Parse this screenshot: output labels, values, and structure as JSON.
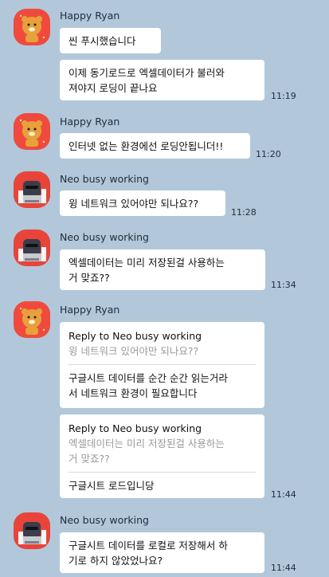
{
  "users": {
    "ryan": "Happy Ryan",
    "neo": "Neo busy working"
  },
  "messages": {
    "m1": "씬 푸시했습니다",
    "m2_line1": "이제 동기로드로 엑셀데이터가 불러와",
    "m2_line2": "져야지 로딩이 끝나요",
    "m3": "인터넷 없는 환경에선 로딩안됩니더!!",
    "m4": "윙 네트워크 있어야만 되나요??",
    "m5_line1": "엑셀데이터는 미리 저장된걸 사용하는",
    "m5_line2": "거 맞죠??",
    "m6_reply_head": "Reply to Neo busy working",
    "m6_reply_quote": "윙 네트워크 있어야만 되나요??",
    "m6_line1": "구글시트 데이터를 순간 순간 읽는거라",
    "m6_line2": "서 네트워크 환경이 필요합니다",
    "m7_reply_head": "Reply to Neo busy working",
    "m7_reply_quote_line1": "엑셀데이터는 미리 저장된걸 사용하는",
    "m7_reply_quote_line2": "거 맞죠??",
    "m7": "구글시트 로드입니당",
    "m8_line1": "구글시트 데이터를 로컬로 저장해서 하",
    "m8_line2": "기로 하지 않았었나요?"
  },
  "times": {
    "t1": "11:19",
    "t2": "11:20",
    "t3": "11:28",
    "t4": "11:34",
    "t5": "11:44",
    "t6": "11:44"
  },
  "colors": {
    "background": "#b2c7da",
    "bubble": "#ffffff",
    "ryan_avatar": "#f04a3e",
    "neo_avatar": "#e8443a"
  },
  "icons": {
    "ryan": "ryan-lion-avatar-icon",
    "neo": "neo-working-avatar-icon"
  }
}
